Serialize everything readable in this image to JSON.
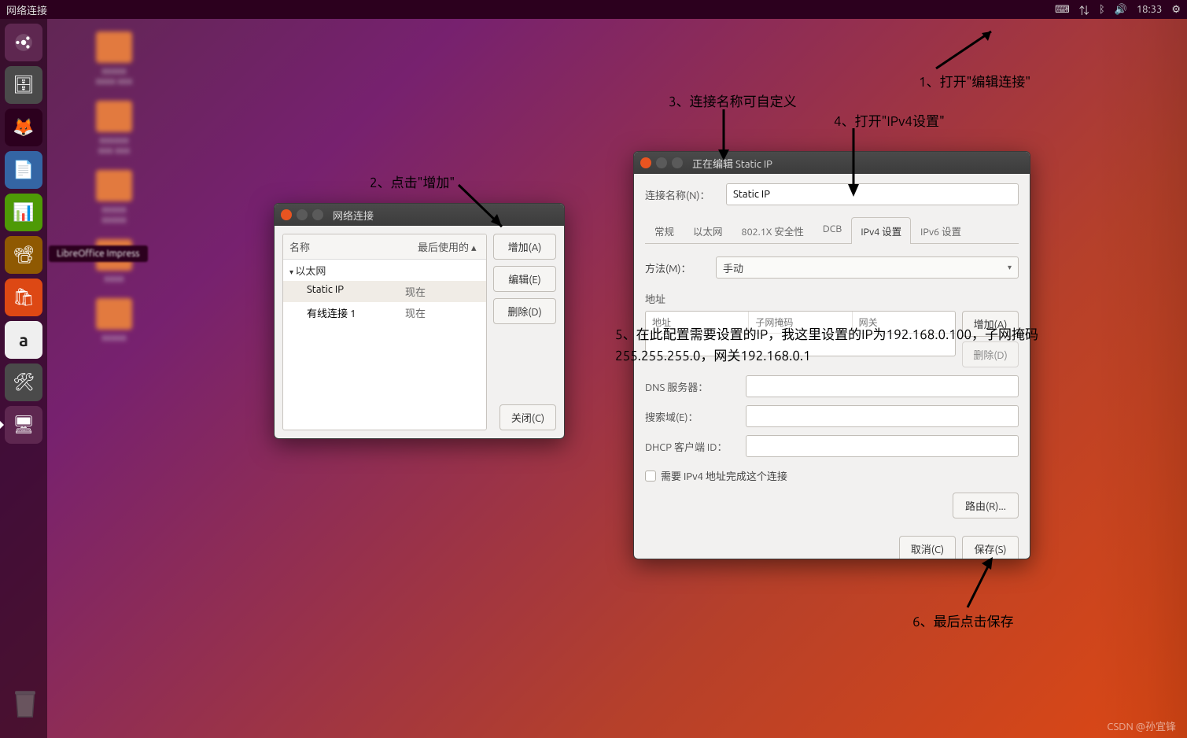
{
  "topbar": {
    "title": "网络连接",
    "time": "18:33"
  },
  "tooltip_text": "LibreOffice Impress",
  "annotations": {
    "a1": "1、打开\"编辑连接\"",
    "a2": "2、点击\"增加\"",
    "a3": "3、连接名称可自定义",
    "a4": "4、打开\"IPv4设置\"",
    "a5": "5、在此配置需要设置的IP，我这里设置的IP为192.168.0.100，子网掩码255.255.255.0，网关192.168.0.1",
    "a6": "6、最后点击保存"
  },
  "win1": {
    "title": "网络连接",
    "col_name": "名称",
    "col_last": "最后使用的 ▴",
    "group_eth": "以太网",
    "rows": [
      {
        "name": "Static IP",
        "last": "现在"
      },
      {
        "name": "有线连接 1",
        "last": "现在"
      }
    ],
    "btn_add": "增加(A)",
    "btn_edit": "编辑(E)",
    "btn_del": "删除(D)",
    "btn_close": "关闭(C)"
  },
  "win2": {
    "title": "正在编辑 Static IP",
    "name_label": "连接名称(N)：",
    "name_value": "Static IP",
    "tabs": [
      "常规",
      "以太网",
      "802.1X 安全性",
      "DCB",
      "IPv4 设置",
      "IPv6 设置"
    ],
    "active_tab_index": 4,
    "method_label": "方法(M)：",
    "method_value": "手动",
    "addr_label": "地址",
    "addr_cols": [
      "地址",
      "子网掩码",
      "网关"
    ],
    "addr_add": "增加(A)",
    "addr_del": "删除(D)",
    "dns_label": "DNS 服务器：",
    "search_label": "搜索域(E)：",
    "dhcp_label": "DHCP 客户端 ID：",
    "chk_label": "需要 IPv4 地址完成这个连接",
    "route_btn": "路由(R)...",
    "cancel": "取消(C)",
    "save": "保存(S)"
  },
  "watermark": "CSDN @孙宜锋"
}
